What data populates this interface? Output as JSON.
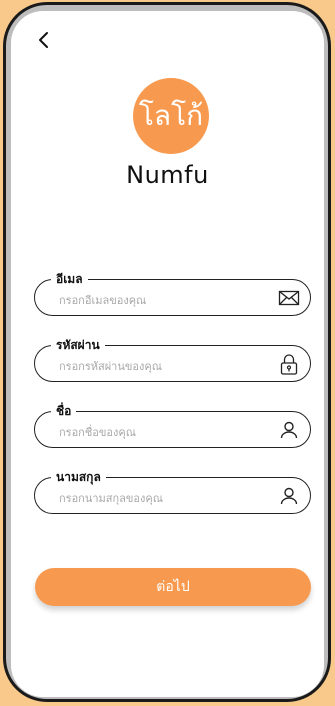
{
  "app": {
    "logo_text": "โลโก้",
    "brand_name": "Numfu"
  },
  "form": {
    "email": {
      "label": "อีเมล",
      "placeholder": "กรอกอีเมลของคุณ",
      "icon": "envelope-icon"
    },
    "password": {
      "label": "รหัสผ่าน",
      "placeholder": "กรอกรหัสผ่านของคุณ",
      "icon": "lock-icon"
    },
    "first_name": {
      "label": "ชื่อ",
      "placeholder": "กรอกชื่อของคุณ",
      "icon": "user-icon"
    },
    "last_name": {
      "label": "นามสกุล",
      "placeholder": "กรอกนามสกุลของคุณ",
      "icon": "user-icon"
    }
  },
  "actions": {
    "next_label": "ต่อไป"
  },
  "colors": {
    "accent": "#f79a4f",
    "background": "#f9c98b"
  }
}
